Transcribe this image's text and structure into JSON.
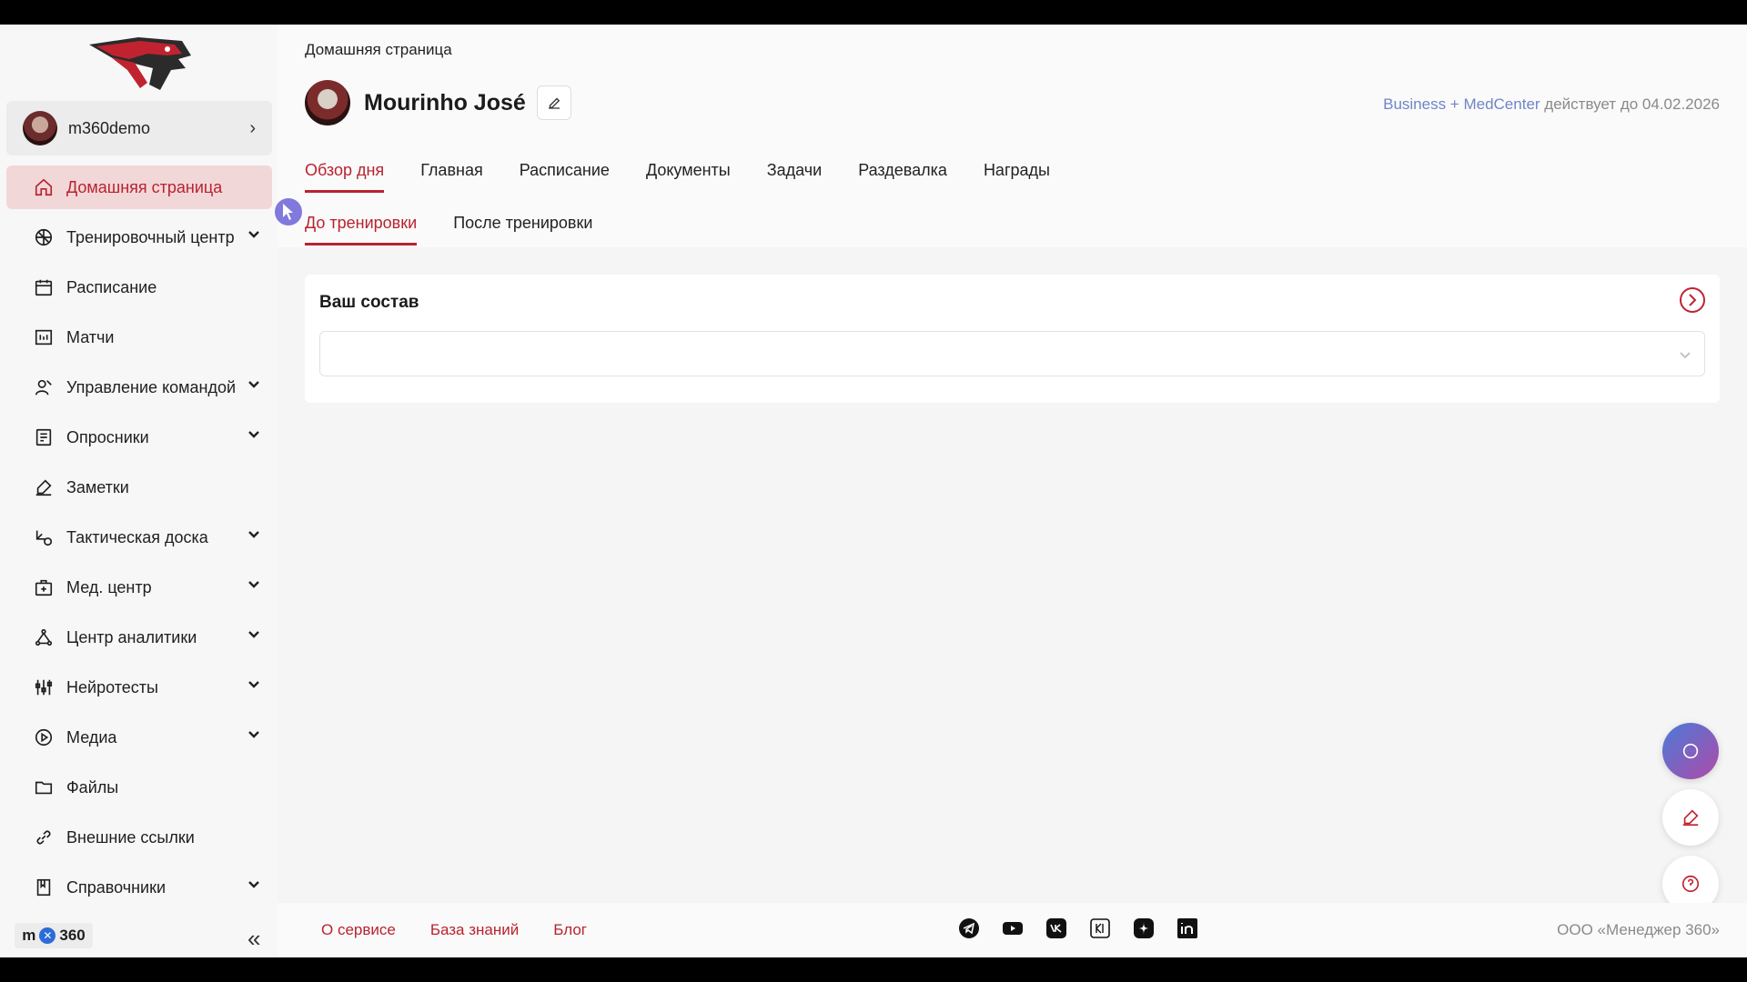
{
  "sidebar": {
    "user": {
      "name": "m360demo"
    },
    "items": [
      {
        "label": "Домашняя страница",
        "icon": "home-icon",
        "active": true,
        "expandable": false
      },
      {
        "label": "Тренировочный центр",
        "icon": "ball-icon",
        "expandable": true
      },
      {
        "label": "Расписание",
        "icon": "calendar-icon",
        "expandable": false
      },
      {
        "label": "Матчи",
        "icon": "scoreboard-icon",
        "expandable": false
      },
      {
        "label": "Управление командой",
        "icon": "team-icon",
        "expandable": true
      },
      {
        "label": "Опросники",
        "icon": "survey-icon",
        "expandable": true
      },
      {
        "label": "Заметки",
        "icon": "marker-icon",
        "expandable": false
      },
      {
        "label": "Тактическая доска",
        "icon": "tactic-board-icon",
        "expandable": true
      },
      {
        "label": "Мед. центр",
        "icon": "medkit-icon",
        "expandable": true
      },
      {
        "label": "Центр аналитики",
        "icon": "analytics-icon",
        "expandable": true
      },
      {
        "label": "Нейротесты",
        "icon": "sliders-icon",
        "expandable": true
      },
      {
        "label": "Медиа",
        "icon": "play-icon",
        "expandable": true
      },
      {
        "label": "Файлы",
        "icon": "folder-icon",
        "expandable": false
      },
      {
        "label": "Внешние ссылки",
        "icon": "link-icon",
        "expandable": false
      },
      {
        "label": "Справочники",
        "icon": "book-icon",
        "expandable": true
      }
    ],
    "brand": {
      "m": "m",
      "num": "360"
    }
  },
  "header": {
    "breadcrumb": "Домашняя страница",
    "profile_name": "Mourinho José",
    "subscription_plan": "Business + MedCenter",
    "subscription_rest": "действует до 04.02.2026",
    "tabs": [
      "Обзор дня",
      "Главная",
      "Расписание",
      "Документы",
      "Задачи",
      "Раздевалка",
      "Награды"
    ],
    "subtabs": [
      "До тренировки",
      "После тренировки"
    ]
  },
  "card": {
    "title": "Ваш состав",
    "select_value": ""
  },
  "footer": {
    "links": [
      "О сервисе",
      "База знаний",
      "Блог"
    ],
    "socials": [
      "telegram-icon",
      "youtube-icon",
      "vk-icon",
      "yandex-zen-icon",
      "dzen-star-icon",
      "linkedin-icon"
    ],
    "copyright": "ООО «Менеджер 360»"
  },
  "colors": {
    "accent": "#b8232f",
    "active_bg": "#f2d7d9",
    "plan_blue": "#6f86c6"
  }
}
